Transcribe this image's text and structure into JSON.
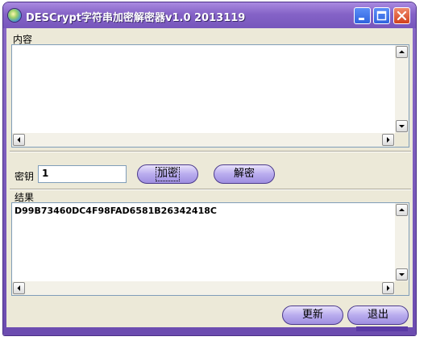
{
  "window": {
    "title": "DESCrypt字符串加密解密器v1.0 2013119",
    "app_icon": "globe-icon"
  },
  "titlebar_buttons": {
    "minimize_icon": "minimize-icon",
    "maximize_icon": "maximize-icon",
    "close_icon": "close-icon"
  },
  "content_section": {
    "label": "内容",
    "text": ""
  },
  "key": {
    "label": "密钥",
    "value": "1"
  },
  "buttons": {
    "encrypt": "加密",
    "decrypt": "解密",
    "update": "更新",
    "exit": "退出"
  },
  "result_section": {
    "label": "结果",
    "text": "D99B73460DC4F98FAD6581B26342418C"
  },
  "colors": {
    "title_bar": "#8563c7",
    "button_fill": "#b9acee",
    "client_bg": "#ece9d8"
  }
}
